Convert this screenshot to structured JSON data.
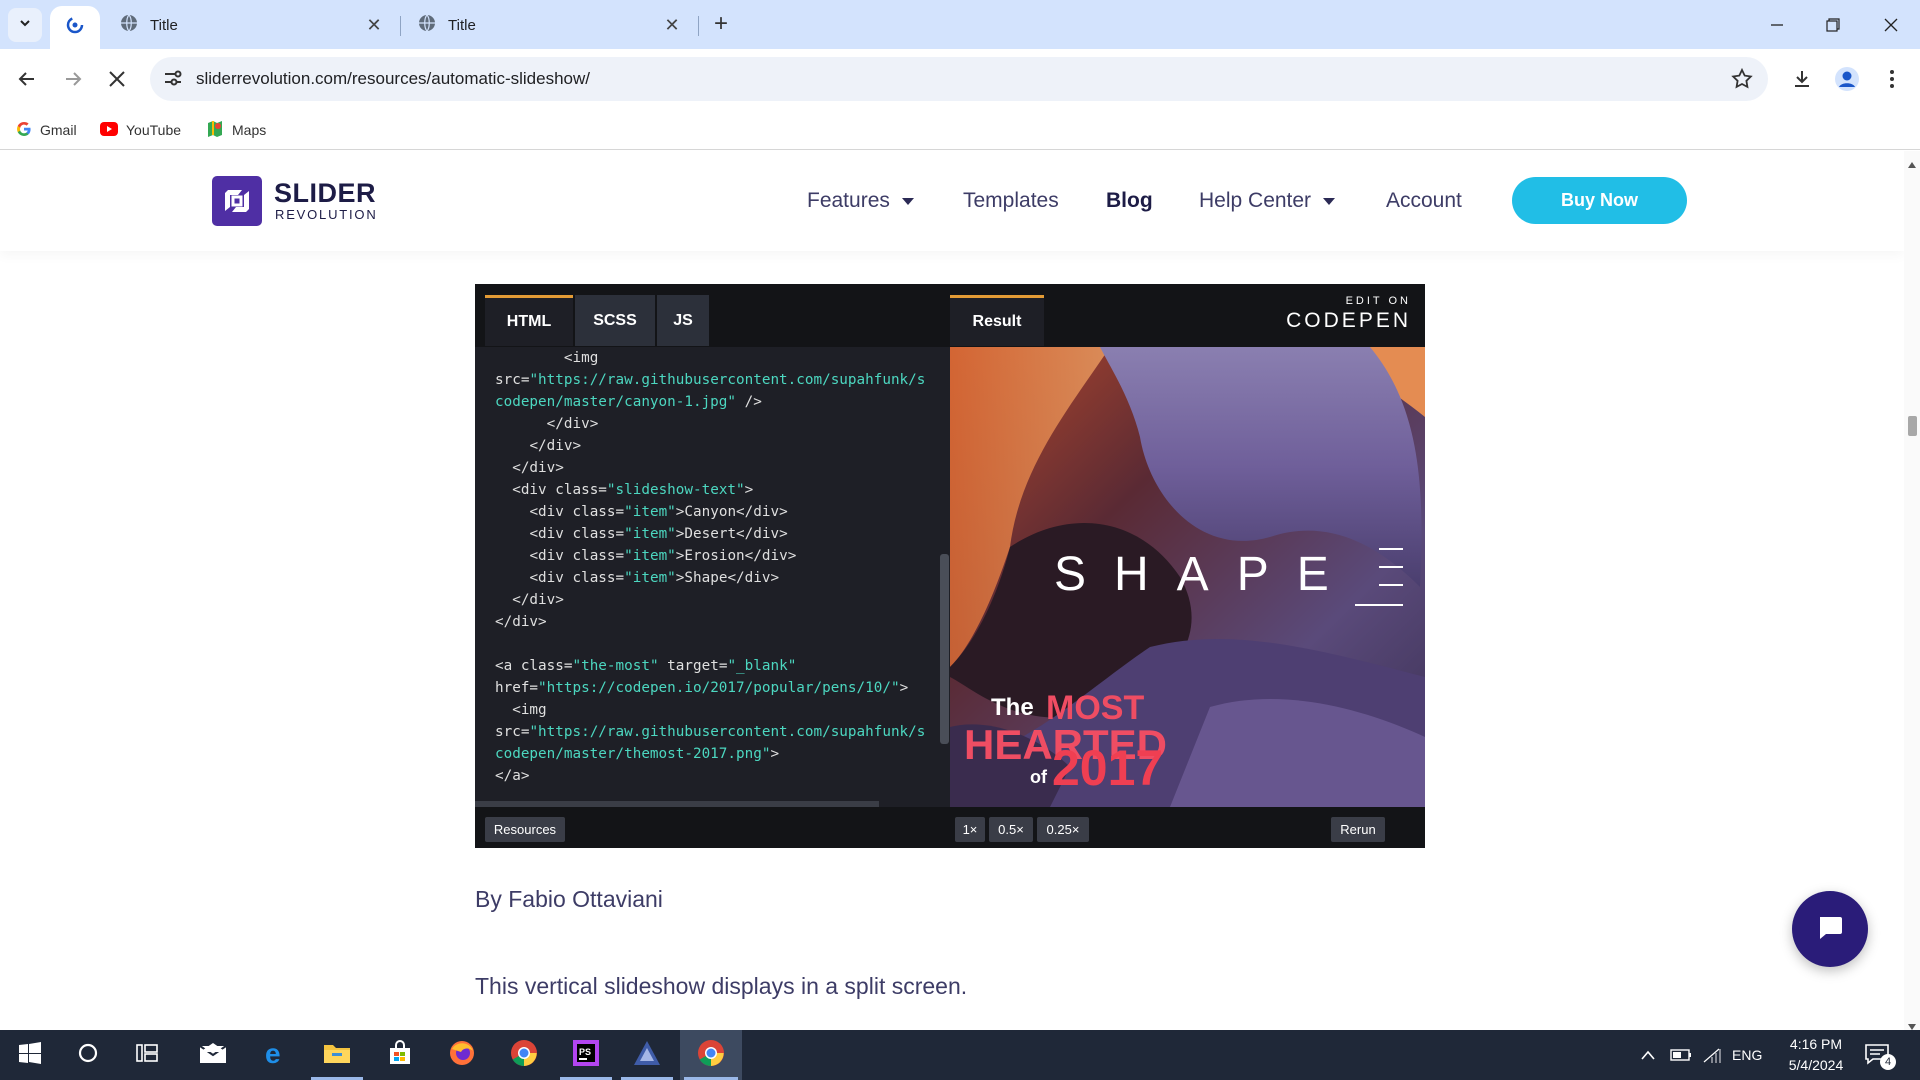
{
  "browser": {
    "tabs": [
      {
        "title": "Title"
      },
      {
        "title": "Title"
      }
    ],
    "url": "sliderrevolution.com/resources/automatic-slideshow/",
    "bookmarks": [
      {
        "label": "Gmail",
        "icon": "google-icon"
      },
      {
        "label": "YouTube",
        "icon": "youtube-icon"
      },
      {
        "label": "Maps",
        "icon": "maps-icon"
      }
    ]
  },
  "site": {
    "logo_main": "SLIDER",
    "logo_sub": "REVOLUTION",
    "nav": {
      "features": "Features",
      "templates": "Templates",
      "blog": "Blog",
      "help": "Help Center",
      "account": "Account"
    },
    "buy_label": "Buy Now"
  },
  "codepen": {
    "tabs": {
      "html": "HTML",
      "scss": "SCSS",
      "js": "JS",
      "result": "Result"
    },
    "edit_on": "EDIT ON",
    "brand": "CODEPEN",
    "code_lines": [
      [
        [
          "p",
          "        "
        ],
        [
          "t",
          "<img"
        ]
      ],
      [
        [
          "a",
          "src="
        ],
        [
          "v",
          "\"https://raw.githubusercontent.com/supahfunk/s"
        ]
      ],
      [
        [
          "v",
          "codepen/master/canyon-1.jpg\""
        ],
        [
          "t",
          " />"
        ]
      ],
      [
        [
          "p",
          "      "
        ],
        [
          "t",
          "</div>"
        ]
      ],
      [
        [
          "p",
          "    "
        ],
        [
          "t",
          "</div>"
        ]
      ],
      [
        [
          "p",
          "  "
        ],
        [
          "t",
          "</div>"
        ]
      ],
      [
        [
          "p",
          "  "
        ],
        [
          "t",
          "<div "
        ],
        [
          "a",
          "class="
        ],
        [
          "v",
          "\"slideshow-text\""
        ],
        [
          "t",
          ">"
        ]
      ],
      [
        [
          "p",
          "    "
        ],
        [
          "t",
          "<div "
        ],
        [
          "a",
          "class="
        ],
        [
          "v",
          "\"item\""
        ],
        [
          "t",
          ">Canyon</div>"
        ]
      ],
      [
        [
          "p",
          "    "
        ],
        [
          "t",
          "<div "
        ],
        [
          "a",
          "class="
        ],
        [
          "v",
          "\"item\""
        ],
        [
          "t",
          ">Desert</div>"
        ]
      ],
      [
        [
          "p",
          "    "
        ],
        [
          "t",
          "<div "
        ],
        [
          "a",
          "class="
        ],
        [
          "v",
          "\"item\""
        ],
        [
          "t",
          ">Erosion</div>"
        ]
      ],
      [
        [
          "p",
          "    "
        ],
        [
          "t",
          "<div "
        ],
        [
          "a",
          "class="
        ],
        [
          "v",
          "\"item\""
        ],
        [
          "t",
          ">Shape</div>"
        ]
      ],
      [
        [
          "p",
          "  "
        ],
        [
          "t",
          "</div>"
        ]
      ],
      [
        [
          "t",
          "</div>"
        ]
      ],
      [
        [
          "p",
          ""
        ]
      ],
      [
        [
          "t",
          "<a "
        ],
        [
          "a",
          "class="
        ],
        [
          "v",
          "\"the-most\""
        ],
        [
          "a",
          " target="
        ],
        [
          "v",
          "\"_blank\""
        ]
      ],
      [
        [
          "a",
          "href="
        ],
        [
          "v",
          "\"https://codepen.io/2017/popular/pens/10/\""
        ],
        [
          "t",
          ">"
        ]
      ],
      [
        [
          "p",
          "  "
        ],
        [
          "t",
          "<img"
        ]
      ],
      [
        [
          "a",
          "src="
        ],
        [
          "v",
          "\"https://raw.githubusercontent.com/supahfunk/s"
        ]
      ],
      [
        [
          "v",
          "codepen/master/themost-2017.png\""
        ],
        [
          "t",
          ">"
        ]
      ],
      [
        [
          "t",
          "</a>"
        ]
      ]
    ],
    "result_word": "SHAPE",
    "badge": {
      "the": "The",
      "most": "MOST",
      "hearted": "HEARTED",
      "of": "of",
      "year": "2017"
    },
    "resources_label": "Resources",
    "zoom": [
      "1×",
      "0.5×",
      "0.25×"
    ],
    "rerun_label": "Rerun"
  },
  "article": {
    "author": "By Fabio Ottaviani",
    "description": "This vertical slideshow displays in a split screen."
  },
  "taskbar": {
    "lang": "ENG",
    "time": "4:16 PM",
    "date": "5/4/2024",
    "notifications": "4"
  },
  "colors": {
    "brand_purple": "#4f2fa4",
    "buy_button": "#21bee6",
    "chat_button": "#2a1c79",
    "tab_accent": "#e39b35"
  }
}
